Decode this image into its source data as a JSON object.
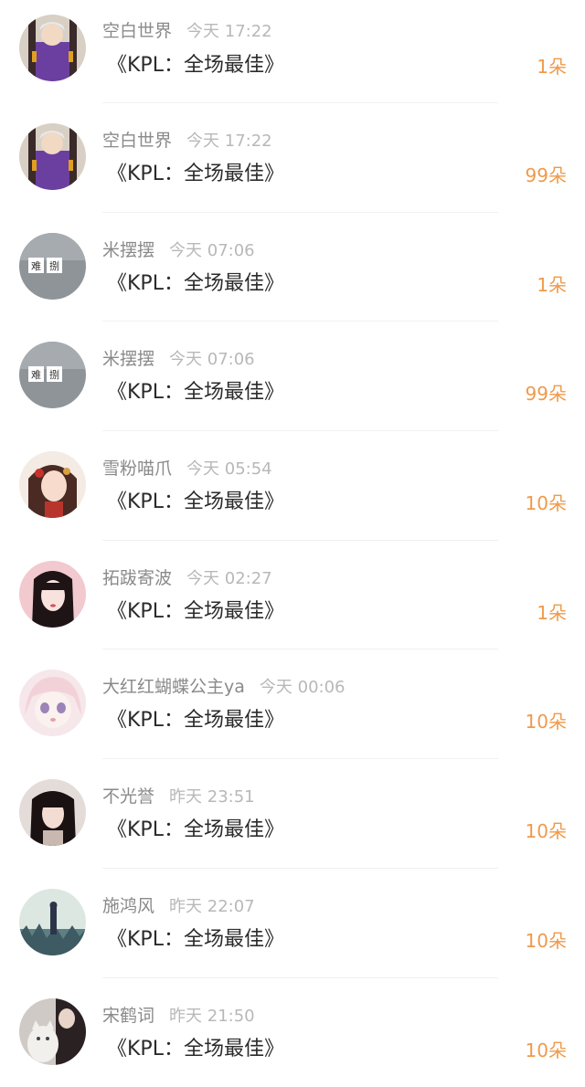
{
  "records": [
    {
      "name": "空白世界",
      "time": "今天 17:22",
      "gift": "《KPL：全场最佳》",
      "amount": "1朵",
      "avatar": "anime-purple"
    },
    {
      "name": "空白世界",
      "time": "今天 17:22",
      "gift": "《KPL：全场最佳》",
      "amount": "99朵",
      "avatar": "anime-purple"
    },
    {
      "name": "米摆摆",
      "time": "今天 07:06",
      "gift": "《KPL：全场最佳》",
      "amount": "1朵",
      "avatar": "gray-stamp"
    },
    {
      "name": "米摆摆",
      "time": "今天 07:06",
      "gift": "《KPL：全场最佳》",
      "amount": "99朵",
      "avatar": "gray-stamp"
    },
    {
      "name": "雪粉喵爪",
      "time": "今天 05:54",
      "gift": "《KPL：全场最佳》",
      "amount": "10朵",
      "avatar": "painted-girl"
    },
    {
      "name": "拓跋寄波",
      "time": "今天 02:27",
      "gift": "《KPL：全场最佳》",
      "amount": "1朵",
      "avatar": "pink-girl"
    },
    {
      "name": "大红红蝴蝶公主ya",
      "time": "今天 00:06",
      "gift": "《KPL：全场最佳》",
      "amount": "10朵",
      "avatar": "anime-pastel"
    },
    {
      "name": "不光誉",
      "time": "昨天 23:51",
      "gift": "《KPL：全场最佳》",
      "amount": "10朵",
      "avatar": "dark-hair-girl"
    },
    {
      "name": "施鸿风",
      "time": "昨天 22:07",
      "gift": "《KPL：全场最佳》",
      "amount": "10朵",
      "avatar": "field-girl"
    },
    {
      "name": "宋鹤词",
      "time": "昨天 21:50",
      "gift": "《KPL：全场最佳》",
      "amount": "10朵",
      "avatar": "cat-photo"
    }
  ]
}
